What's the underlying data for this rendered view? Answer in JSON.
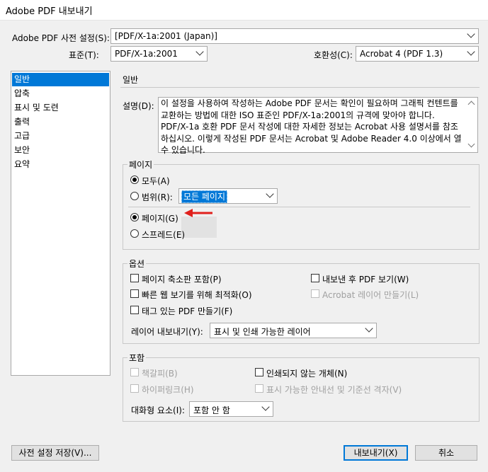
{
  "window": {
    "title": "Adobe PDF 내보내기"
  },
  "header": {
    "preset_label": "Adobe PDF 사전 설정(S):",
    "preset_value": "[PDF/X-1a:2001 (Japan)]",
    "standard_label": "표준(T):",
    "standard_value": "PDF/X-1a:2001",
    "compat_label": "호환성(C):",
    "compat_value": "Acrobat 4 (PDF 1.3)"
  },
  "sidebar": {
    "items": [
      {
        "label": "일반",
        "selected": true
      },
      {
        "label": "압축"
      },
      {
        "label": "표시 및 도련"
      },
      {
        "label": "출력"
      },
      {
        "label": "고급"
      },
      {
        "label": "보안"
      },
      {
        "label": "요약"
      }
    ]
  },
  "main": {
    "heading": "일반",
    "desc_label": "설명(D):",
    "description": "이 설정을 사용하여 작성하는 Adobe PDF 문서는 확인이 필요하며 그래픽 컨텐트를 교환하는 방법에 대한 ISO 표준인 PDF/X-1a:2001의 규격에 맞아야 합니다. PDF/X-1a 호환 PDF 문서 작성에 대한 자세한 정보는 Acrobat 사용 설명서를 참조하십시오. 이렇게 작성된 PDF 문서는 Acrobat 및 Adobe Reader 4.0 이상에서 열 수 있습니다.",
    "pages": {
      "title": "페이지",
      "all_label": "모두(A)",
      "range_label": "범위(R):",
      "range_value": "모든 페이지",
      "pages_label": "페이지(G)",
      "spreads_label": "스프레드(E)"
    },
    "options": {
      "title": "옵션",
      "embed_thumbnails": "페이지 축소판 포함(P)",
      "optimize_web": "빠른 웹 보기를 위해 최적화(O)",
      "tagged_pdf": "태그 있는 PDF 만들기(F)",
      "view_after": "내보낸 후 PDF 보기(W)",
      "acrobat_layers": "Acrobat 레이어 만들기(L)",
      "export_layers_label": "레이어 내보내기(Y):",
      "export_layers_value": "표시 및 인쇄 가능한 레이어"
    },
    "include": {
      "title": "포함",
      "bookmarks": "책갈피(B)",
      "hyperlinks": "하이퍼링크(H)",
      "non_printing": "인쇄되지 않는 개체(N)",
      "guides": "표시 가능한 안내선 및 기준선 격자(V)",
      "interactive_label": "대화형 요소(I):",
      "interactive_value": "포함 안 함"
    }
  },
  "footer": {
    "save_preset": "사전 설정 저장(V)...",
    "export": "내보내기(X)",
    "cancel": "취소"
  },
  "colors": {
    "accent": "#0078d7",
    "annotation_arrow": "#e0201c"
  }
}
